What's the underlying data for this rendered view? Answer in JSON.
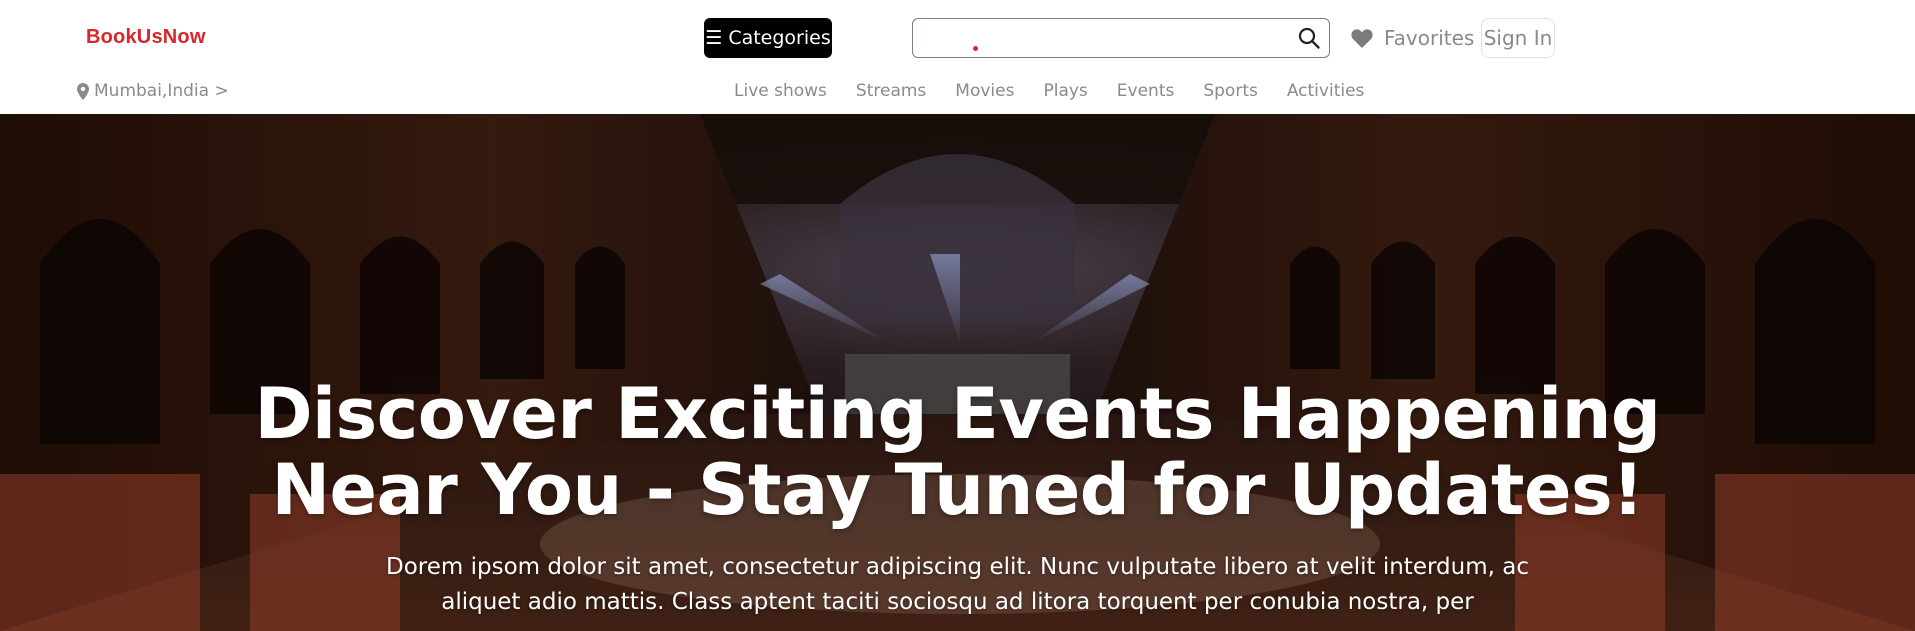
{
  "brand": {
    "name": "BookUsNow",
    "color": "#d7262e"
  },
  "header": {
    "categories_label": "Categories",
    "menu_icon": "hamburger-menu-icon",
    "search": {
      "value": "",
      "placeholder": ""
    },
    "search_icon": "search-icon",
    "favorites_label": "Favorites",
    "favorites_icon": "heart-icon",
    "signin_label": "Sign In"
  },
  "location": {
    "text": "Mumbai,India >",
    "icon": "location-pin-icon"
  },
  "nav": {
    "items": [
      {
        "label": "Live shows"
      },
      {
        "label": "Streams"
      },
      {
        "label": "Movies"
      },
      {
        "label": "Plays"
      },
      {
        "label": "Events"
      },
      {
        "label": "Sports"
      },
      {
        "label": "Activities"
      }
    ]
  },
  "hero": {
    "title": "Discover Exciting Events Happening Near You - Stay Tuned for Updates!",
    "subtitle": "Dorem ipsom dolor sit amet, consectetur adipiscing elit. Nunc vulputate libero at velit interdum, ac aliquet adio mattis. Class aptent taciti sociosqu ad litora torquent per conubia nostra, per"
  },
  "colors": {
    "accent": "#d7262e",
    "muted_text": "#8a8a8a",
    "button_dark": "#000000"
  }
}
